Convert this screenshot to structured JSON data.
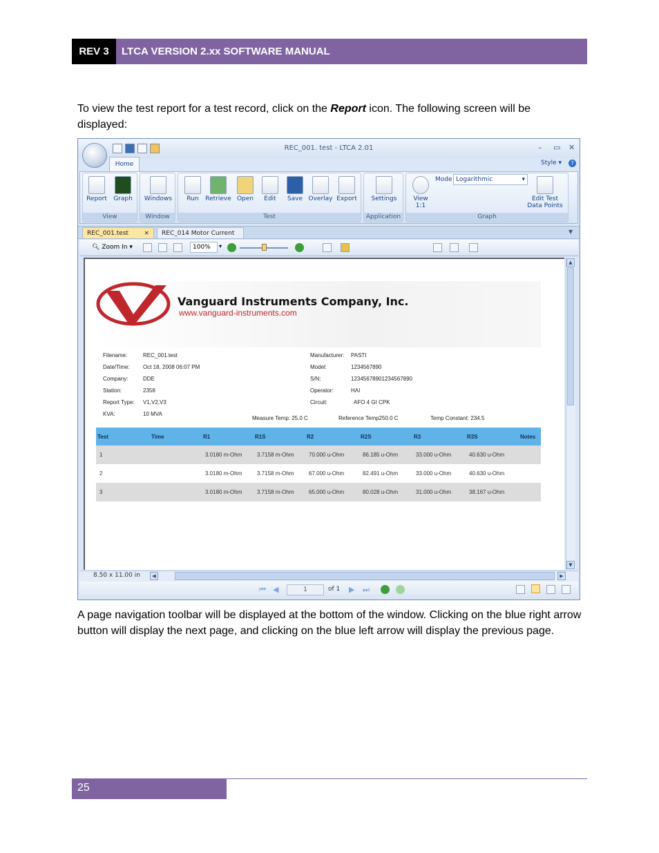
{
  "header": {
    "rev": "REV 3",
    "title": "LTCA VERSION 2.xx SOFTWARE MANUAL"
  },
  "intro": {
    "before": "To view the test report for a test record, click on the ",
    "bold": "Report",
    "after": " icon. The following screen will be displayed:"
  },
  "window": {
    "title": "REC_001. test - LTCA 2.01",
    "ctrl_min": "–",
    "ctrl_max": "▭",
    "ctrl_close": "✕",
    "home_tab": "Home",
    "style_label": "Style",
    "help": "?",
    "groups": [
      {
        "label": "View",
        "buttons": [
          "Report",
          "Graph"
        ]
      },
      {
        "label": "Window",
        "buttons": [
          "Windows"
        ]
      },
      {
        "label": "Test",
        "buttons": [
          "Run",
          "Retrieve",
          "Open",
          "Edit",
          "Save",
          "Overlay",
          "Export"
        ]
      },
      {
        "label": "Application",
        "buttons": [
          "Settings"
        ]
      },
      {
        "label": "Graph",
        "buttons": [
          "View 1:1",
          "Edit Test Data Points"
        ]
      }
    ],
    "mode_label": "Mode",
    "mode_value": "Logarithmic",
    "doc_tabs": [
      "REC_001.test",
      "REC_014 Motor Current"
    ],
    "doc_tab_close": "×",
    "zoom_label": "Zoom In",
    "zoom_percent": "100%",
    "page_size": "8.50 x 11.00 in",
    "page_number": "1",
    "page_of": "of 1"
  },
  "report": {
    "company": "Vanguard Instruments Company, Inc.",
    "website": "www.vanguard-instruments.com",
    "left_info": [
      {
        "label": "Filename:",
        "value": "REC_001.test"
      },
      {
        "label": "Date/Time:",
        "value": "Oct 18, 2008 06:07 PM"
      },
      {
        "label": "Company:",
        "value": "DDE"
      },
      {
        "label": "Station:",
        "value": "2358"
      },
      {
        "label": "Report Type:",
        "value": "V1,V2,V3"
      },
      {
        "label": "KVA:",
        "value": "10 MVA"
      }
    ],
    "right_info": [
      {
        "label": "Manufacturer:",
        "value": "PASTI"
      },
      {
        "label": "Model:",
        "value": "1234567890"
      },
      {
        "label": "S/N:",
        "value": "12345678901234567890"
      },
      {
        "label": "Operator:",
        "value": "HAI"
      },
      {
        "label": "Circuit:",
        "value": "AFO 4 GI CPK"
      }
    ],
    "measure_temp": "Measure Temp:  25.0 C",
    "reference_temp": "Reference Temp250.0 C",
    "temp_constant": "Temp Constant:  234.5",
    "columns": [
      "Test",
      "Time",
      "R1",
      "R1S",
      "R2",
      "R2S",
      "R3",
      "R3S",
      "Notes"
    ],
    "rows": [
      [
        "1",
        "",
        "3.0180 m-Ohm",
        "3.7158 m-Ohm",
        "70.000 u-Ohm",
        "86.185 u-Ohm",
        "33.000 u-Ohm",
        "40.630 u-Ohm",
        ""
      ],
      [
        "2",
        "",
        "3.0180 m-Ohm",
        "3.7158 m-Ohm",
        "67.000 u-Ohm",
        "82.491 u-Ohm",
        "33.000 u-Ohm",
        "40.630 u-Ohm",
        ""
      ],
      [
        "3",
        "",
        "3.0180 m-Ohm",
        "3.7158 m-Ohm",
        "65.000 u-Ohm",
        "80.028 u-Ohm",
        "31.000 u-Ohm",
        "38.167 u-Ohm",
        ""
      ]
    ]
  },
  "outro": "A page navigation toolbar will be displayed at the bottom of the window. Clicking on the blue right arrow button will display the next page, and clicking on the blue left arrow will display the previous page.",
  "footer": {
    "page": "25"
  },
  "colors": {
    "header_purple": "#8064a2",
    "table_header": "#5fb3e8",
    "logo_red": "#c0272d"
  }
}
